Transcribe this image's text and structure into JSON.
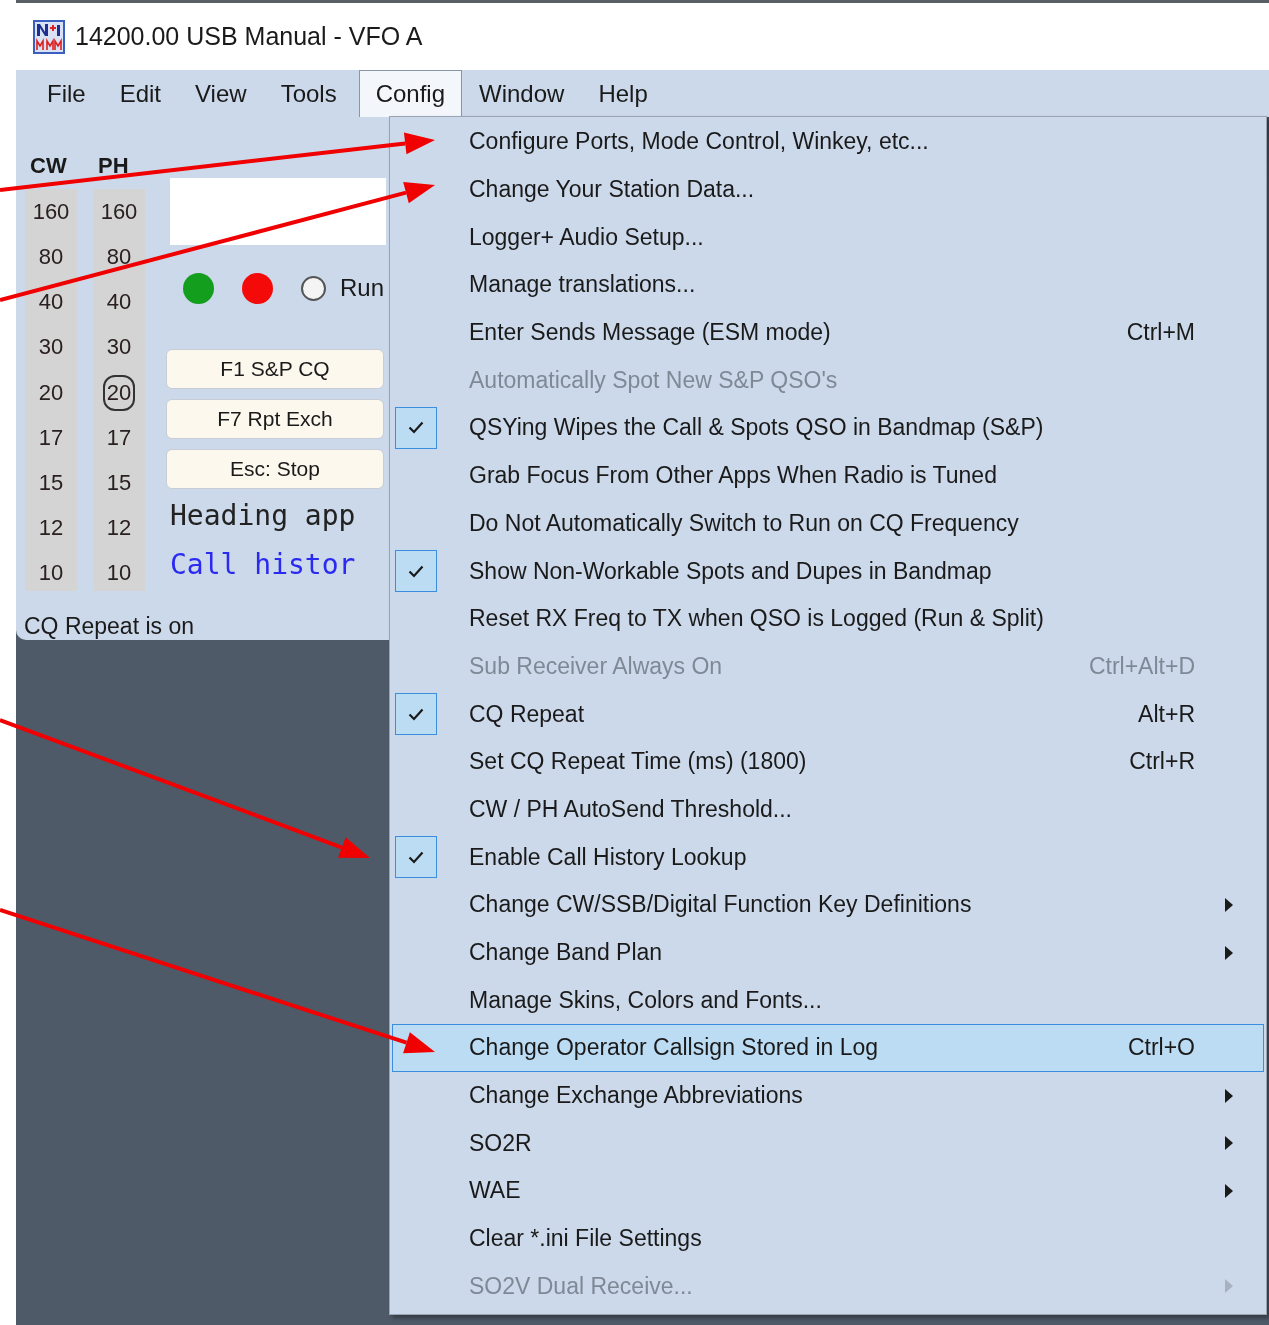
{
  "window": {
    "title": "14200.00 USB Manual - VFO A"
  },
  "menu_bar": [
    {
      "label": "File",
      "selected": false
    },
    {
      "label": "Edit",
      "selected": false
    },
    {
      "label": "View",
      "selected": false
    },
    {
      "label": "Tools",
      "selected": false
    },
    {
      "label": "Config",
      "selected": true
    },
    {
      "label": "Window",
      "selected": false
    },
    {
      "label": "Help",
      "selected": false
    }
  ],
  "band_columns": [
    {
      "header": "CW",
      "bands": [
        {
          "label": "160",
          "selected": false
        },
        {
          "label": "80",
          "selected": false
        },
        {
          "label": "40",
          "selected": false
        },
        {
          "label": "30",
          "selected": false
        },
        {
          "label": "20",
          "selected": false
        },
        {
          "label": "17",
          "selected": false
        },
        {
          "label": "15",
          "selected": false
        },
        {
          "label": "12",
          "selected": false
        },
        {
          "label": "10",
          "selected": false
        }
      ]
    },
    {
      "header": "PH",
      "bands": [
        {
          "label": "160",
          "selected": false
        },
        {
          "label": "80",
          "selected": false
        },
        {
          "label": "40",
          "selected": false
        },
        {
          "label": "30",
          "selected": false
        },
        {
          "label": "20",
          "selected": true
        },
        {
          "label": "17",
          "selected": false
        },
        {
          "label": "15",
          "selected": false
        },
        {
          "label": "12",
          "selected": false
        },
        {
          "label": "10",
          "selected": false
        }
      ]
    }
  ],
  "indicators": [
    {
      "color": "#149e1e"
    },
    {
      "color": "#f50a0a"
    }
  ],
  "mode_radio": {
    "label": "Run",
    "selected": false
  },
  "function_keys": [
    {
      "label": "F1 S&P CQ"
    },
    {
      "label": "F7 Rpt Exch"
    },
    {
      "label": "Esc: Stop"
    }
  ],
  "info_lines": [
    {
      "text": "Heading app",
      "kind": "heading"
    },
    {
      "text": "Call histor",
      "kind": "call_history"
    }
  ],
  "status_bar": {
    "text": "CQ Repeat is on"
  },
  "config_menu": {
    "items": [
      {
        "label": "Configure Ports, Mode Control, Winkey, etc...",
        "checked": false,
        "disabled": false,
        "submenu": false,
        "selected": false
      },
      {
        "label": "Change Your Station Data...",
        "checked": false,
        "disabled": false,
        "submenu": false,
        "selected": false
      },
      {
        "label": "Logger+ Audio Setup...",
        "checked": false,
        "disabled": false,
        "submenu": false,
        "selected": false
      },
      {
        "label": "Manage translations...",
        "checked": false,
        "disabled": false,
        "submenu": false,
        "selected": false
      },
      {
        "label": "Enter Sends Message (ESM mode)",
        "shortcut": "Ctrl+M",
        "checked": false,
        "disabled": false,
        "submenu": false,
        "selected": false
      },
      {
        "label": "Automatically Spot New S&P QSO's",
        "checked": false,
        "disabled": true,
        "submenu": false,
        "selected": false
      },
      {
        "label": "QSYing Wipes the Call & Spots QSO in Bandmap (S&P)",
        "checked": true,
        "disabled": false,
        "submenu": false,
        "selected": false
      },
      {
        "label": "Grab Focus From Other Apps When Radio is Tuned",
        "checked": false,
        "disabled": false,
        "submenu": false,
        "selected": false
      },
      {
        "label": "Do Not Automatically Switch to Run on CQ Frequency",
        "checked": false,
        "disabled": false,
        "submenu": false,
        "selected": false
      },
      {
        "label": "Show Non-Workable Spots and Dupes in Bandmap",
        "checked": true,
        "disabled": false,
        "submenu": false,
        "selected": false
      },
      {
        "label": "Reset RX Freq to TX when QSO is Logged (Run & Split)",
        "checked": false,
        "disabled": false,
        "submenu": false,
        "selected": false
      },
      {
        "label": "Sub Receiver Always On",
        "shortcut": "Ctrl+Alt+D",
        "checked": false,
        "disabled": true,
        "submenu": false,
        "selected": false
      },
      {
        "label": "CQ Repeat",
        "shortcut": "Alt+R",
        "checked": true,
        "disabled": false,
        "submenu": false,
        "selected": false
      },
      {
        "label": "Set CQ Repeat Time (ms) (1800)",
        "shortcut": "Ctrl+R",
        "checked": false,
        "disabled": false,
        "submenu": false,
        "selected": false
      },
      {
        "label": "CW / PH AutoSend Threshold...",
        "checked": false,
        "disabled": false,
        "submenu": false,
        "selected": false
      },
      {
        "label": "Enable Call History Lookup",
        "checked": true,
        "disabled": false,
        "submenu": false,
        "selected": false
      },
      {
        "label": "Change CW/SSB/Digital Function Key Definitions",
        "checked": false,
        "disabled": false,
        "submenu": true,
        "selected": false
      },
      {
        "label": "Change Band Plan",
        "checked": false,
        "disabled": false,
        "submenu": true,
        "selected": false
      },
      {
        "label": "Manage Skins, Colors and Fonts...",
        "checked": false,
        "disabled": false,
        "submenu": false,
        "selected": false
      },
      {
        "label": "Change Operator Callsign Stored in Log",
        "shortcut": "Ctrl+O",
        "checked": false,
        "disabled": false,
        "submenu": false,
        "selected": true
      },
      {
        "label": "Change Exchange Abbreviations",
        "checked": false,
        "disabled": false,
        "submenu": true,
        "selected": false
      },
      {
        "label": "SO2R",
        "checked": false,
        "disabled": false,
        "submenu": true,
        "selected": false
      },
      {
        "label": "WAE",
        "checked": false,
        "disabled": false,
        "submenu": true,
        "selected": false
      },
      {
        "label": "Clear *.ini File Settings",
        "checked": false,
        "disabled": false,
        "submenu": false,
        "selected": false
      },
      {
        "label": "SO2V Dual Receive...",
        "checked": false,
        "disabled": true,
        "submenu": true,
        "selected": false
      }
    ]
  }
}
